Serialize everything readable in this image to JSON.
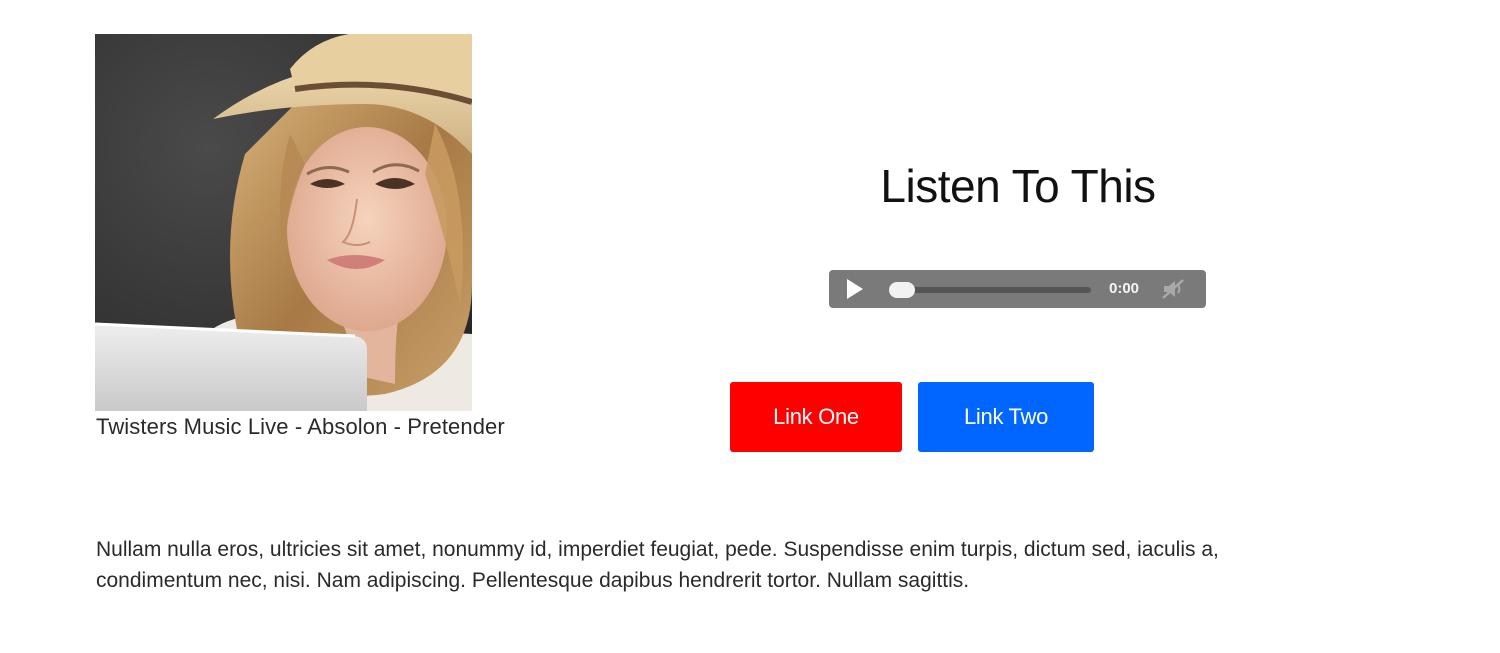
{
  "photo": {
    "alt": "Woman wearing a straw hat smiling at a laptop"
  },
  "caption": "Twisters Music Live - Absolon - Pretender",
  "title": "Listen To This",
  "player": {
    "time": "0:00",
    "progress": 0,
    "muted": true
  },
  "buttons": {
    "link_one": "Link One",
    "link_two": "Link Two"
  },
  "body_text": "Nullam nulla eros, ultricies sit amet, nonummy id, imperdiet feugiat, pede. Suspendisse enim turpis, dictum sed, iaculis a, condimentum nec, nisi. Nam adipiscing. Pellentesque dapibus hendrerit tortor. Nullam sagittis.",
  "colors": {
    "link_one_bg": "#ff0000",
    "link_two_bg": "#0066ff",
    "player_bg": "#7a7a7a"
  },
  "icons": {
    "play": "play-icon",
    "volume": "mute-icon"
  }
}
